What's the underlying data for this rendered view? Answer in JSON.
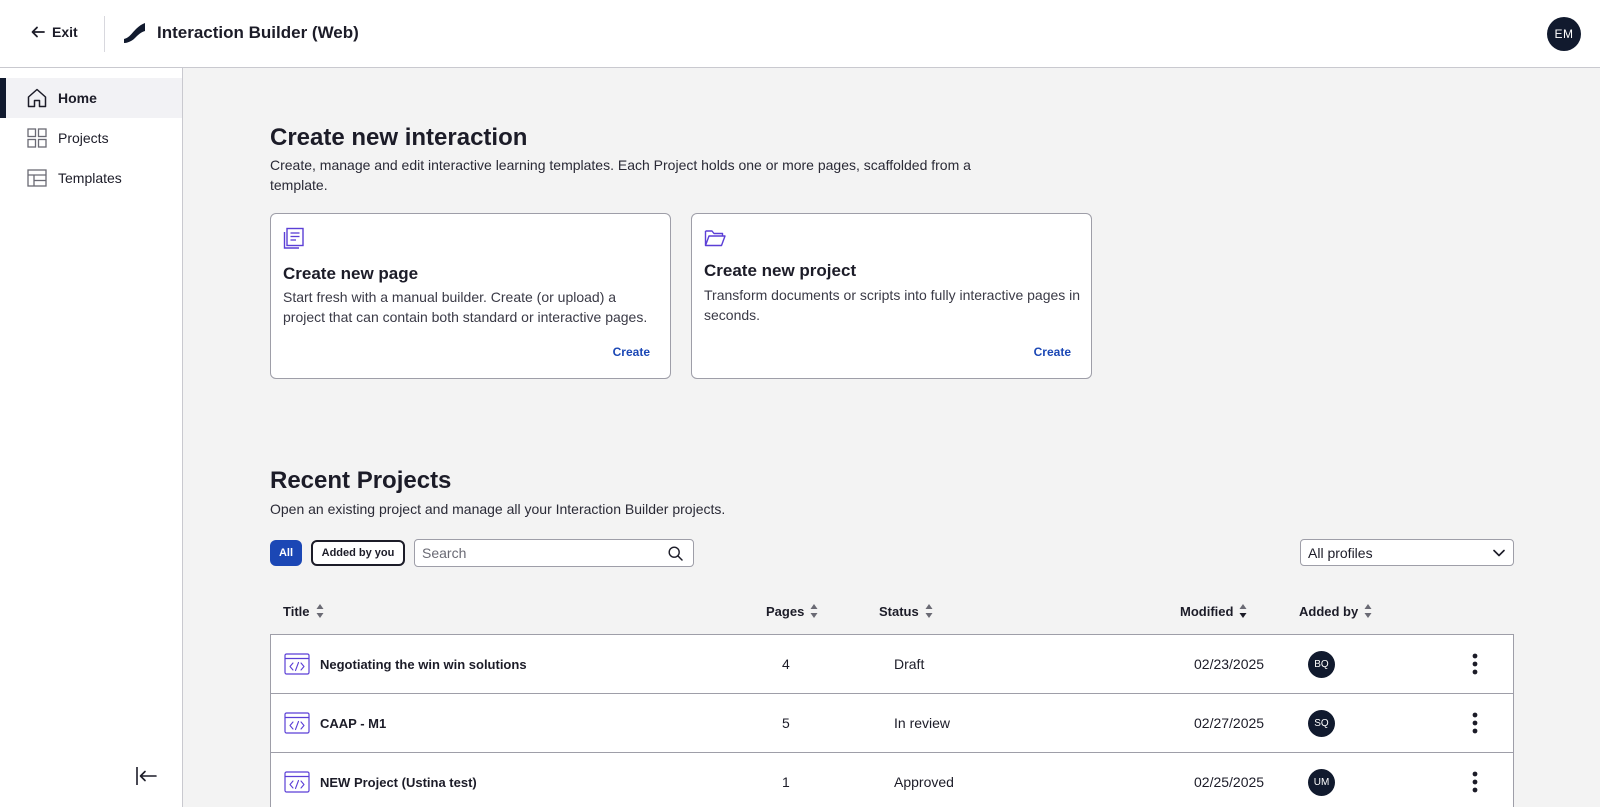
{
  "header": {
    "exit_label": "Exit",
    "app_title": "Interaction Builder (Web)",
    "user_initials": "EM"
  },
  "sidebar": {
    "items": [
      {
        "label": "Home",
        "icon": "home-icon",
        "active": true
      },
      {
        "label": "Projects",
        "icon": "grid-icon",
        "active": false
      },
      {
        "label": "Templates",
        "icon": "template-icon",
        "active": false
      }
    ]
  },
  "create_section": {
    "title": "Create new interaction",
    "description": "Create, manage and edit interactive learning templates. Each Project holds one or more pages, scaffolded from a template.",
    "cards": [
      {
        "icon": "document-icon",
        "title": "Create new page",
        "description": "Start fresh with a manual builder. Create (or upload) a project that can contain both standard or interactive pages.",
        "link": "Create"
      },
      {
        "icon": "folder-icon",
        "title": "Create new project",
        "description": "Transform documents or scripts into fully interactive pages in seconds.",
        "link": "Create"
      }
    ]
  },
  "recent_section": {
    "title": "Recent Projects",
    "description": "Open an existing project and manage all your Interaction Builder projects.",
    "filters": {
      "all_label": "All",
      "added_by_you_label": "Added by you",
      "search_placeholder": "Search",
      "profile_select_value": "All profiles"
    },
    "columns": {
      "title": "Title",
      "pages": "Pages",
      "status": "Status",
      "modified": "Modified",
      "added_by": "Added by"
    },
    "rows": [
      {
        "title": "Negotiating the win win solutions",
        "pages": "4",
        "status": "Draft",
        "modified": "02/23/2025",
        "added_by": "BQ"
      },
      {
        "title": "CAAP - M1",
        "pages": "5",
        "status": "In review",
        "modified": "02/27/2025",
        "added_by": "SQ"
      },
      {
        "title": "NEW Project (Ustina test)",
        "pages": "1",
        "status": "Approved",
        "modified": "02/25/2025",
        "added_by": "UM"
      }
    ]
  },
  "colors": {
    "accent_blue": "#1b47b5",
    "icon_purple": "#5b3fd6",
    "navy": "#111a2e"
  }
}
